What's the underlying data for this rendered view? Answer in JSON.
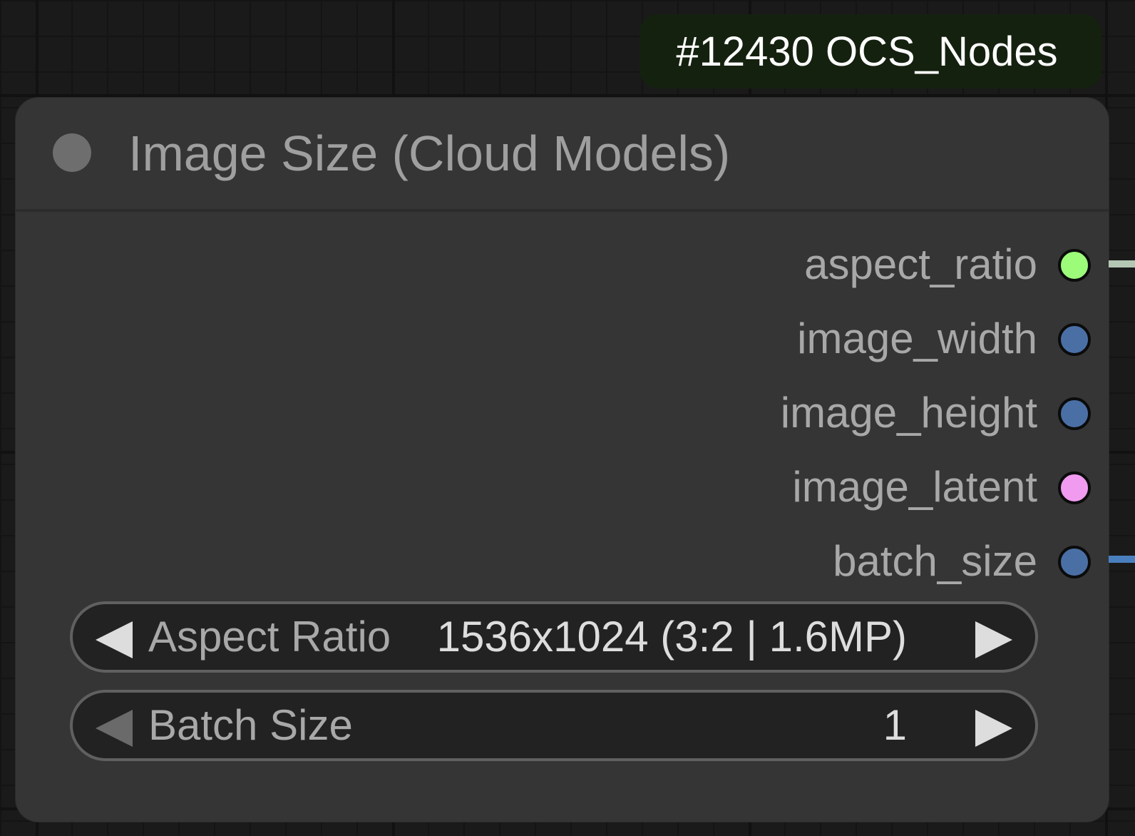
{
  "badge": {
    "text": "#12430 OCS_Nodes"
  },
  "node": {
    "title": "Image Size (Cloud Models)",
    "outputs": [
      {
        "label": "aspect_ratio",
        "color": "#9cfc7a",
        "linked": true,
        "link_color": "#b4c6b4"
      },
      {
        "label": "image_width",
        "color": "#4a6fa5",
        "linked": false
      },
      {
        "label": "image_height",
        "color": "#4a6fa5",
        "linked": false
      },
      {
        "label": "image_latent",
        "color": "#f09bf0",
        "linked": false
      },
      {
        "label": "batch_size",
        "color": "#4a6fa5",
        "linked": true,
        "link_color": "#4a7fbf"
      }
    ],
    "widgets": [
      {
        "label": "Aspect Ratio",
        "value": "1536x1024 (3:2 | 1.6MP)",
        "left_arrow_dimmed": false
      },
      {
        "label": "Batch Size",
        "value": "1",
        "left_arrow_dimmed": true
      }
    ]
  }
}
